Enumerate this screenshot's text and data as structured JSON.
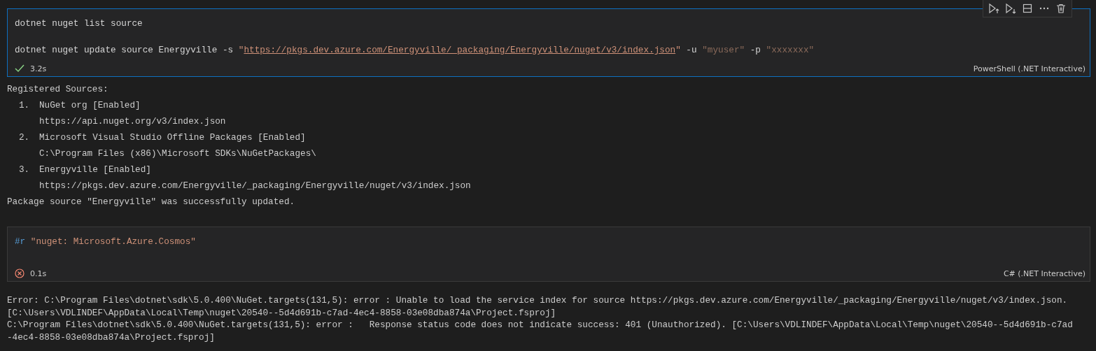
{
  "cells": [
    {
      "selected": true,
      "failed": false,
      "duration": "3.2s",
      "language": "PowerShell (.NET Interactive)",
      "code_blocks": [
        {
          "lines": [
            {
              "tokens": [
                {
                  "kind": "plain",
                  "text": "dotnet nuget list source"
                }
              ]
            }
          ]
        },
        {
          "lines": [
            {
              "tokens": [
                {
                  "kind": "plain",
                  "text": "dotnet nuget update source Energyville -s "
                },
                {
                  "kind": "string",
                  "text": "\""
                },
                {
                  "kind": "url",
                  "text": "https://pkgs.dev.azure.com/Energyville/_packaging/Energyville/nuget/v3/index.json"
                },
                {
                  "kind": "string",
                  "text": "\""
                },
                {
                  "kind": "plain",
                  "text": " -u "
                },
                {
                  "kind": "redacted",
                  "text": "\"myuser\""
                },
                {
                  "kind": "plain",
                  "text": " -p "
                },
                {
                  "kind": "redacted",
                  "text": "\"xxxxxxx\""
                }
              ]
            }
          ]
        }
      ],
      "output": {
        "heading": "Registered Sources:",
        "sources": [
          {
            "number": "1.",
            "name": "NuGet org [Enabled]",
            "location": "https://api.nuget.org/v3/index.json"
          },
          {
            "number": "2.",
            "name": "Microsoft Visual Studio Offline Packages [Enabled]",
            "location": "C:\\Program Files (x86)\\Microsoft SDKs\\NuGetPackages\\"
          },
          {
            "number": "3.",
            "name": "Energyville [Enabled]",
            "location": "https://pkgs.dev.azure.com/Energyville/_packaging/Energyville/nuget/v3/index.json"
          }
        ],
        "message": "Package source \"Energyville\" was successfully updated."
      }
    },
    {
      "selected": false,
      "failed": true,
      "duration": "0.1s",
      "language": "C# (.NET Interactive)",
      "code_blocks": [
        {
          "lines": [
            {
              "tokens": [
                {
                  "kind": "keyword",
                  "text": "#r"
                },
                {
                  "kind": "string",
                  "text": " \"nuget: Microsoft.Azure.Cosmos\""
                }
              ]
            }
          ]
        }
      ],
      "error_lines": [
        "Error: C:\\Program Files\\dotnet\\sdk\\5.0.400\\NuGet.targets(131,5): error : Unable to load the service index for source https://pkgs.dev.azure.com/Energyville/_packaging/Energyville/nuget/v3/index.json.",
        "[C:\\Users\\VDLINDEF\\AppData\\Local\\Temp\\nuget\\20540--5d4d691b-c7ad-4ec4-8858-03e08dba874a\\Project.fsproj]",
        "C:\\Program Files\\dotnet\\sdk\\5.0.400\\NuGet.targets(131,5): error :   Response status code does not indicate success: 401 (Unauthorized). [C:\\Users\\VDLINDEF\\AppData\\Local\\Temp\\nuget\\20540--5d4d691b-c7ad",
        "-4ec4-8858-03e08dba874a\\Project.fsproj]"
      ]
    }
  ]
}
